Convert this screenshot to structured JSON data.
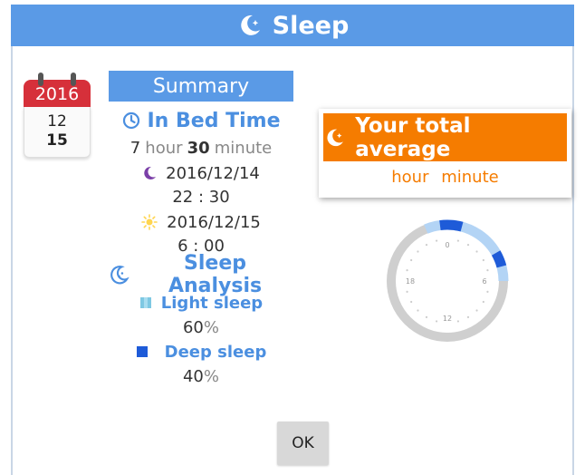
{
  "title_bar": {
    "title": "Sleep",
    "icon": "moon-star-icon",
    "color": "#5a9ae6"
  },
  "calendar": {
    "year": "2016",
    "month": "12",
    "day": "15",
    "icon": "calendar-icon"
  },
  "summary": {
    "header": "Summary",
    "in_bed": {
      "title": "In Bed Time",
      "icon": "clock-icon",
      "hours": "7",
      "hour_unit": "hour",
      "minutes": "30",
      "minute_unit": "minute"
    },
    "start": {
      "icon": "moon-icon",
      "date": "2016/12/14",
      "time": "22 : 30"
    },
    "end": {
      "icon": "sun-icon",
      "date": "2016/12/15",
      "time": "6 : 00"
    }
  },
  "analysis": {
    "title": "Sleep Analysis",
    "icon": "sleep-analysis-icon",
    "light": {
      "label": "Light sleep",
      "value": "60",
      "unit": "%",
      "color": "#7ec8e3"
    },
    "deep": {
      "label": "Deep sleep",
      "value": "40",
      "unit": "%",
      "color": "#1e5bd8"
    }
  },
  "average": {
    "title": "Your total average",
    "icon": "moon-star-icon",
    "hour_unit": "hour",
    "minute_unit": "minute",
    "accent": "#f57c00"
  },
  "clock": {
    "labels": [
      "0",
      "6",
      "12",
      "18"
    ],
    "light_hours": [
      22.5,
      6.0
    ],
    "deep_hours": [
      [
        23.5,
        1.0
      ],
      [
        4.0,
        5.0
      ]
    ]
  },
  "ok_label": "OK"
}
